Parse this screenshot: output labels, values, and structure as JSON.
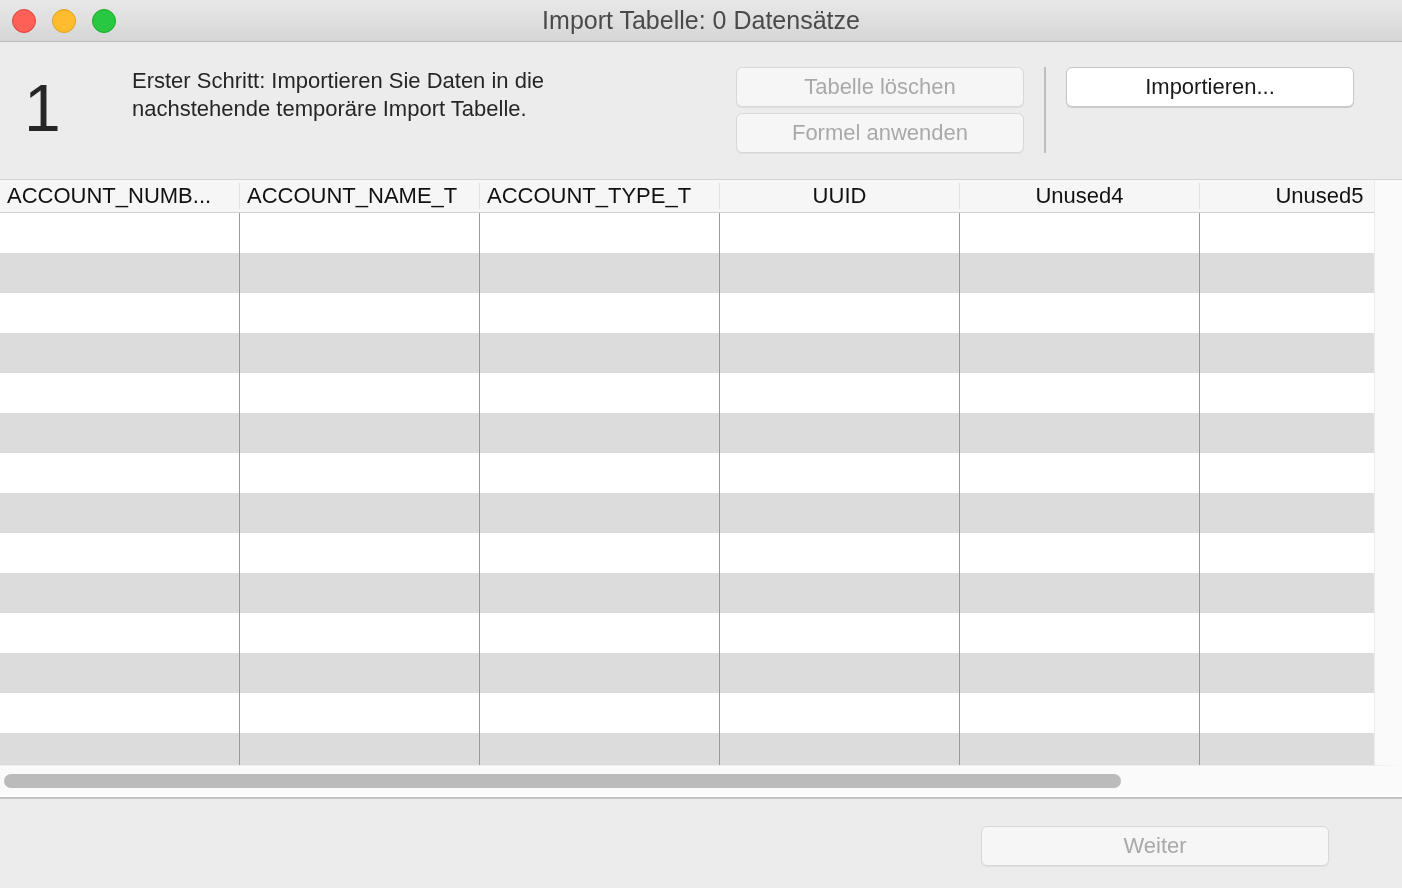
{
  "window": {
    "title": "Import Tabelle: 0 Datensätze"
  },
  "step": {
    "number": "1",
    "description": "Erster Schritt: Importieren Sie Daten in die nachstehende temporäre Import Tabelle."
  },
  "buttons": [
    {
      "label": "Tabelle löschen",
      "disabled": true
    },
    {
      "label": "Formel anwenden",
      "disabled": true
    },
    {
      "label": "Importieren...",
      "disabled": false
    }
  ],
  "table": {
    "columns": [
      {
        "label": "ACCOUNT_NUMB..."
      },
      {
        "label": "ACCOUNT_NAME_T"
      },
      {
        "label": "ACCOUNT_TYPE_T"
      },
      {
        "label": "UUID"
      },
      {
        "label": "Unused4"
      },
      {
        "label": "Unused5"
      }
    ]
  },
  "footer": {
    "button": {
      "label": "Weiter",
      "disabled": true
    }
  }
}
